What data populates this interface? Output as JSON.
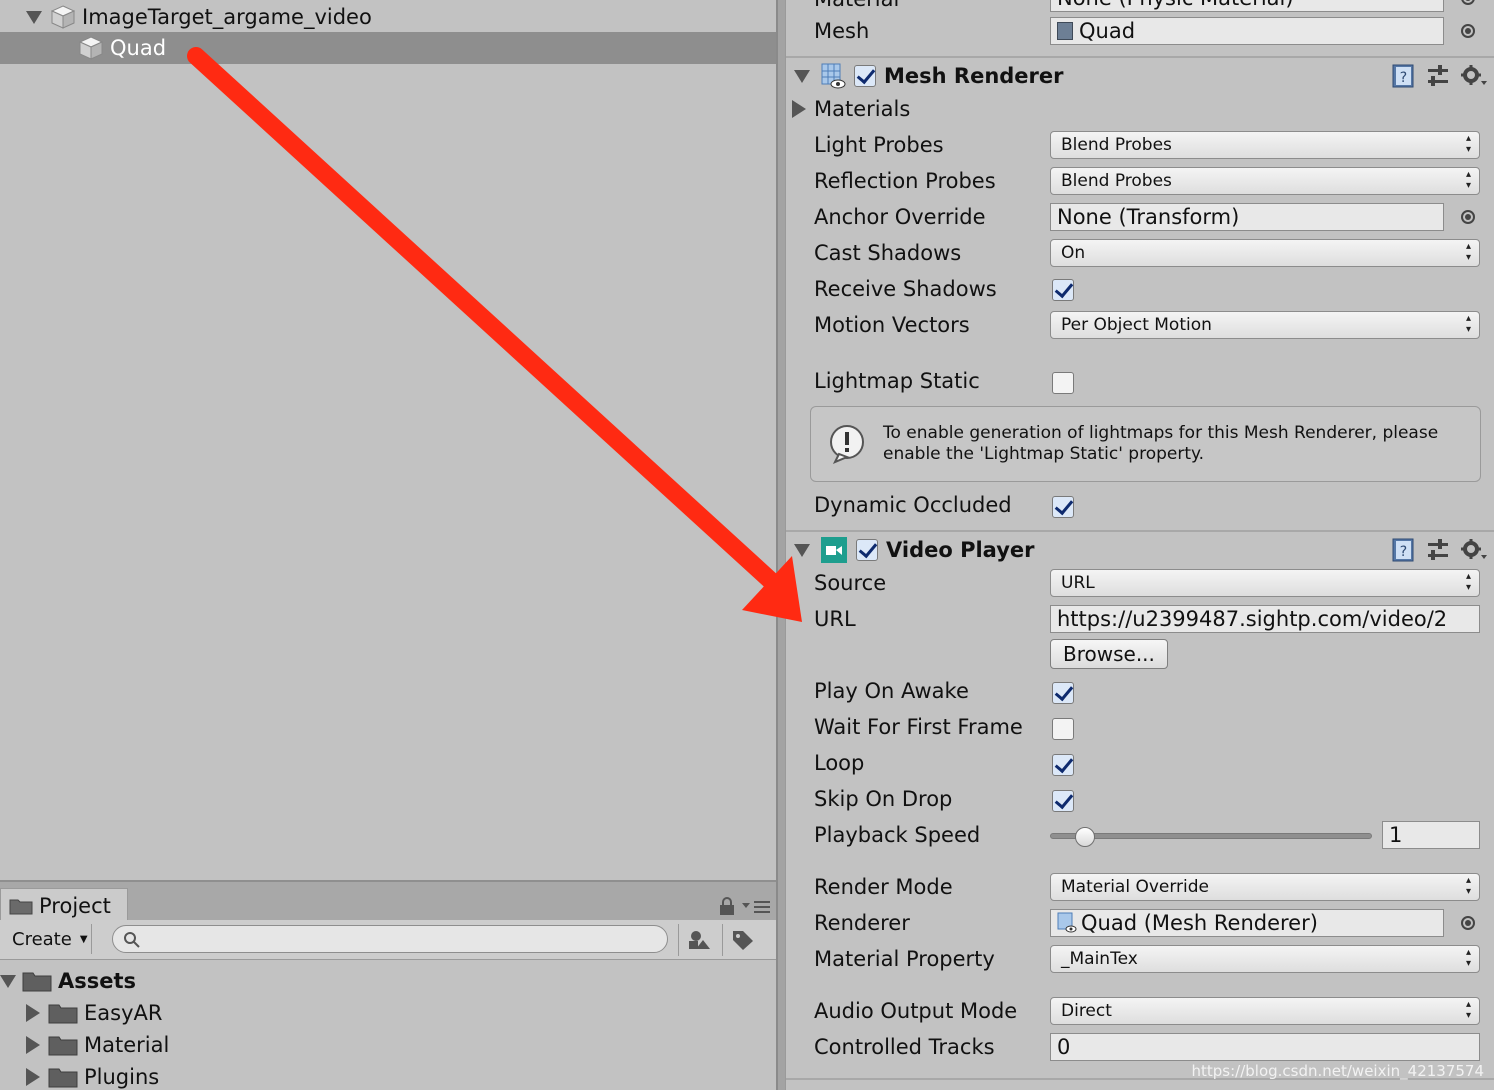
{
  "hierarchy": {
    "items": [
      {
        "label": "ImageTarget_argame_video"
      },
      {
        "label": "Quad"
      }
    ]
  },
  "project": {
    "tab_label": "Project",
    "create_label": "Create",
    "search_placeholder": "",
    "tree": [
      {
        "label": "Assets"
      },
      {
        "label": "EasyAR"
      },
      {
        "label": "Material"
      },
      {
        "label": "Plugins"
      }
    ]
  },
  "inspector": {
    "top": {
      "material_label": "Material",
      "material_value": "None (Physic Material)",
      "mesh_label": "Mesh",
      "mesh_value": "Quad"
    },
    "mesh_renderer": {
      "title": "Mesh Renderer",
      "materials_label": "Materials",
      "light_probes_label": "Light Probes",
      "light_probes_value": "Blend Probes",
      "reflection_probes_label": "Reflection Probes",
      "reflection_probes_value": "Blend Probes",
      "anchor_override_label": "Anchor Override",
      "anchor_override_value": "None (Transform)",
      "cast_shadows_label": "Cast Shadows",
      "cast_shadows_value": "On",
      "receive_shadows_label": "Receive Shadows",
      "motion_vectors_label": "Motion Vectors",
      "motion_vectors_value": "Per Object Motion",
      "lightmap_static_label": "Lightmap Static",
      "help_text_line1": "To enable generation of lightmaps for this Mesh Renderer, please",
      "help_text_line2": "enable the 'Lightmap Static' property.",
      "dynamic_occluded_label": "Dynamic Occluded"
    },
    "video_player": {
      "title": "Video Player",
      "source_label": "Source",
      "source_value": "URL",
      "url_label": "URL",
      "url_value": "https://u2399487.sightp.com/video/2",
      "browse_label": "Browse...",
      "play_on_awake_label": "Play On Awake",
      "wait_first_frame_label": "Wait For First Frame",
      "loop_label": "Loop",
      "skip_on_drop_label": "Skip On Drop",
      "playback_speed_label": "Playback Speed",
      "playback_speed_value": "1",
      "playback_speed_fraction": 0.11,
      "render_mode_label": "Render Mode",
      "render_mode_value": "Material Override",
      "renderer_label": "Renderer",
      "renderer_value": "Quad (Mesh Renderer)",
      "material_property_label": "Material Property",
      "material_property_value": "_MainTex",
      "audio_output_label": "Audio Output Mode",
      "audio_output_value": "Direct",
      "controlled_tracks_label": "Controlled Tracks",
      "controlled_tracks_value": "0"
    }
  },
  "watermark": "https://blog.csdn.net/weixin_42137574",
  "colors": {
    "annotation_arrow": "#ff2a12",
    "selection": "#8e8e8e",
    "panel_bg": "#c2c2c2",
    "video_icon": "#1e9e8e"
  }
}
